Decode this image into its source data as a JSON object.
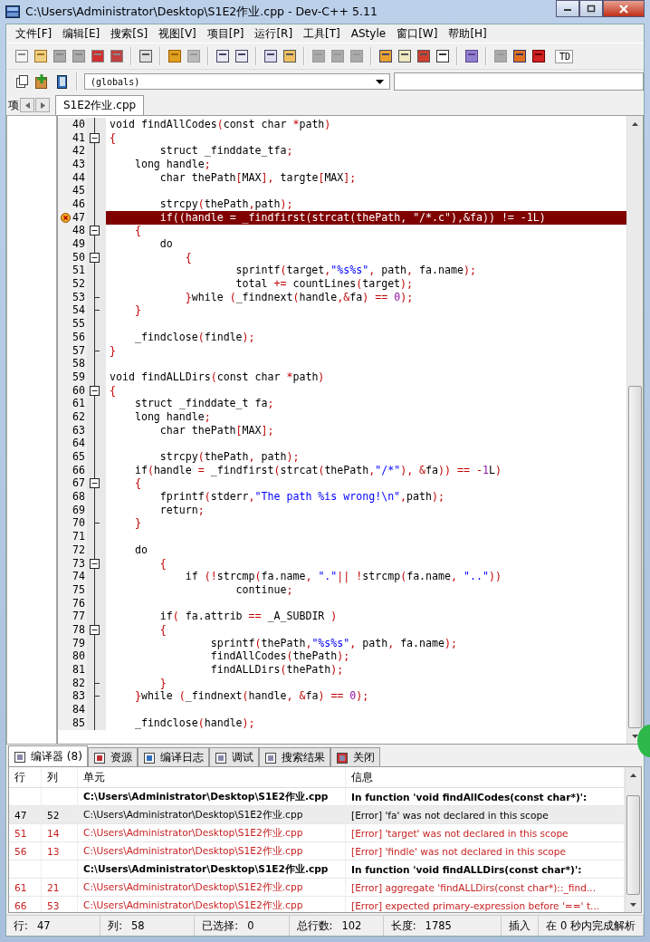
{
  "window": {
    "title": "C:\\Users\\Administrator\\Desktop\\S1E2作业.cpp - Dev-C++ 5.11"
  },
  "menu": [
    "文件[F]",
    "编辑[E]",
    "搜索[S]",
    "视图[V]",
    "项目[P]",
    "运行[R]",
    "工具[T]",
    "AStyle",
    "窗口[W]",
    "帮助[H]"
  ],
  "toolbar_clipped_label": "TD",
  "scope_combo": {
    "value": "(globals)"
  },
  "left_panel": {
    "tab": "项"
  },
  "editor_tabs": [
    {
      "label": "S1E2作业.cpp",
      "selected": true
    }
  ],
  "code": [
    {
      "n": "40",
      "text": "void findAllCodes(const char *path)",
      "fold_box": false,
      "fold_end": false,
      "error": false
    },
    {
      "n": "41",
      "text": "{",
      "fold_box": true,
      "fold_end": false,
      "error": false
    },
    {
      "n": "42",
      "text": "        struct _finddate_tfa;",
      "fold_box": false,
      "fold_end": false,
      "error": false
    },
    {
      "n": "43",
      "text": "    long handle;",
      "fold_box": false,
      "fold_end": false,
      "error": false
    },
    {
      "n": "44",
      "text": "        char thePath[MAX], targte[MAX];",
      "fold_box": false,
      "fold_end": false,
      "error": false
    },
    {
      "n": "45",
      "fold_box": false,
      "fold_end": false,
      "error": false
    },
    {
      "n": "46",
      "text": "        strcpy(thePath,path);",
      "fold_box": false,
      "fold_end": false,
      "error": false
    },
    {
      "n": "47",
      "text": "        if((handle = _findfirst(strcat(thePath, \"/*.c\"),&fa)) != -1L)",
      "fold_box": false,
      "fold_end": false,
      "error": true
    },
    {
      "n": "48",
      "text": "    {",
      "fold_box": true,
      "fold_end": false,
      "error": false
    },
    {
      "n": "49",
      "text": "        do",
      "fold_box": false,
      "fold_end": false,
      "error": false
    },
    {
      "n": "50",
      "text": "            {",
      "fold_box": true,
      "fold_end": false,
      "error": false
    },
    {
      "n": "51",
      "text": "                    sprintf(target,\"%s%s\", path, fa.name);",
      "fold_box": false,
      "fold_end": false,
      "error": false
    },
    {
      "n": "52",
      "text": "                    total += countLines(target);",
      "fold_box": false,
      "fold_end": false,
      "error": false
    },
    {
      "n": "53",
      "text": "            }while (_findnext(handle,&fa) == 0);",
      "fold_box": false,
      "fold_end": true,
      "error": false
    },
    {
      "n": "54",
      "text": "    }",
      "fold_box": false,
      "fold_end": true,
      "error": false
    },
    {
      "n": "55",
      "fold_box": false,
      "fold_end": false,
      "error": false
    },
    {
      "n": "56",
      "text": "    _findclose(findle);",
      "fold_box": false,
      "fold_end": false,
      "error": false
    },
    {
      "n": "57",
      "text": "}",
      "fold_box": false,
      "fold_end": true,
      "error": false
    },
    {
      "n": "58",
      "fold_box": false,
      "fold_end": false,
      "error": false
    },
    {
      "n": "59",
      "text": "void findALLDirs(const char *path)",
      "fold_box": false,
      "fold_end": false,
      "error": false
    },
    {
      "n": "60",
      "text": "{",
      "fold_box": true,
      "fold_end": false,
      "error": false
    },
    {
      "n": "61",
      "text": "    struct _finddate_t fa;",
      "fold_box": false,
      "fold_end": false,
      "error": false
    },
    {
      "n": "62",
      "text": "    long handle;",
      "fold_box": false,
      "fold_end": false,
      "error": false
    },
    {
      "n": "63",
      "text": "        char thePath[MAX];",
      "fold_box": false,
      "fold_end": false,
      "error": false
    },
    {
      "n": "64",
      "fold_box": false,
      "fold_end": false,
      "error": false
    },
    {
      "n": "65",
      "text": "        strcpy(thePath, path);",
      "fold_box": false,
      "fold_end": false,
      "error": false
    },
    {
      "n": "66",
      "text": "    if(handle = _findfirst(strcat(thePath,\"/*\"), &fa)) == -1L)",
      "fold_box": false,
      "fold_end": false,
      "error": false
    },
    {
      "n": "67",
      "text": "    {",
      "fold_box": true,
      "fold_end": false,
      "error": false
    },
    {
      "n": "68",
      "text": "        fprintf(stderr,\"The path %is wrong!\\n\",path);",
      "fold_box": false,
      "fold_end": false,
      "error": false
    },
    {
      "n": "69",
      "text": "        return;",
      "fold_box": false,
      "fold_end": false,
      "error": false
    },
    {
      "n": "70",
      "text": "    }",
      "fold_box": false,
      "fold_end": true,
      "error": false
    },
    {
      "n": "71",
      "fold_box": false,
      "fold_end": false,
      "error": false
    },
    {
      "n": "72",
      "text": "    do",
      "fold_box": false,
      "fold_end": false,
      "error": false
    },
    {
      "n": "73",
      "text": "        {",
      "fold_box": true,
      "fold_end": false,
      "error": false
    },
    {
      "n": "74",
      "text": "            if (!strcmp(fa.name, \".\"|| !strcmp(fa.name, \"..\"))",
      "fold_box": false,
      "fold_end": false,
      "error": false
    },
    {
      "n": "75",
      "text": "                    continue;",
      "fold_box": false,
      "fold_end": false,
      "error": false
    },
    {
      "n": "76",
      "fold_box": false,
      "fold_end": false,
      "error": false
    },
    {
      "n": "77",
      "text": "        if( fa.attrib == _A_SUBDIR )",
      "fold_box": false,
      "fold_end": false,
      "error": false
    },
    {
      "n": "78",
      "text": "        {",
      "fold_box": true,
      "fold_end": false,
      "error": false
    },
    {
      "n": "79",
      "text": "                sprintf(thePath,\"%s%s\", path, fa.name);",
      "fold_box": false,
      "fold_end": false,
      "error": false
    },
    {
      "n": "80",
      "text": "                findAllCodes(thePath);",
      "fold_box": false,
      "fold_end": false,
      "error": false
    },
    {
      "n": "81",
      "text": "                findALLDirs(thePath);",
      "fold_box": false,
      "fold_end": false,
      "error": false
    },
    {
      "n": "82",
      "text": "        }",
      "fold_box": false,
      "fold_end": true,
      "error": false
    },
    {
      "n": "83",
      "text": "    }while (_findnext(handle, &fa) == 0);",
      "fold_box": false,
      "fold_end": true,
      "error": false
    },
    {
      "n": "84",
      "fold_box": false,
      "fold_end": false,
      "error": false
    },
    {
      "n": "85",
      "text": "    _findclose(handle);",
      "fold_box": false,
      "fold_end": false,
      "error": false
    }
  ],
  "bottom_tabs": [
    {
      "label": "编译器 (8)",
      "selected": true
    },
    {
      "label": "资源",
      "selected": false
    },
    {
      "label": "编译日志",
      "selected": false
    },
    {
      "label": "调试",
      "selected": false
    },
    {
      "label": "搜索结果",
      "selected": false
    },
    {
      "label": "关闭",
      "selected": false
    }
  ],
  "messages": {
    "columns": [
      "行",
      "列",
      "单元",
      "信息"
    ],
    "rows": [
      {
        "kind": "header",
        "unit": "C:\\Users\\Administrator\\Desktop\\S1E2作业.cpp",
        "message": "In function 'void findAllCodes(const char*)':",
        "selected": false
      },
      {
        "kind": "error",
        "line": "47",
        "col": "52",
        "unit": "C:\\Users\\Administrator\\Desktop\\S1E2作业.cpp",
        "message": "[Error] 'fa' was not declared in this scope",
        "selected": true
      },
      {
        "kind": "error",
        "line": "51",
        "col": "14",
        "unit": "C:\\Users\\Administrator\\Desktop\\S1E2作业.cpp",
        "message": "[Error] 'target' was not declared in this scope",
        "selected": false
      },
      {
        "kind": "error",
        "line": "56",
        "col": "13",
        "unit": "C:\\Users\\Administrator\\Desktop\\S1E2作业.cpp",
        "message": "[Error] 'findle' was not declared in this scope",
        "selected": false
      },
      {
        "kind": "header",
        "unit": "C:\\Users\\Administrator\\Desktop\\S1E2作业.cpp",
        "message": "In function 'void findALLDirs(const char*)':",
        "selected": false
      },
      {
        "kind": "error",
        "line": "61",
        "col": "21",
        "unit": "C:\\Users\\Administrator\\Desktop\\S1E2作业.cpp",
        "message": "[Error] aggregate 'findALLDirs(const char*)::_find...",
        "selected": false
      },
      {
        "kind": "error",
        "line": "66",
        "col": "53",
        "unit": "C:\\Users\\Administrator\\Desktop\\S1E2作业.cpp",
        "message": "[Error] expected primary-expression before '==' t...",
        "selected": false
      }
    ]
  },
  "status_bar": [
    {
      "label": "行:",
      "value": "47"
    },
    {
      "label": "列:",
      "value": "58"
    },
    {
      "label": "已选择:",
      "value": "0"
    },
    {
      "label": "总行数:",
      "value": "102"
    },
    {
      "label": "长度:",
      "value": "1785"
    },
    {
      "label": "插入"
    },
    {
      "label": "在 0 秒内完成解析"
    }
  ]
}
